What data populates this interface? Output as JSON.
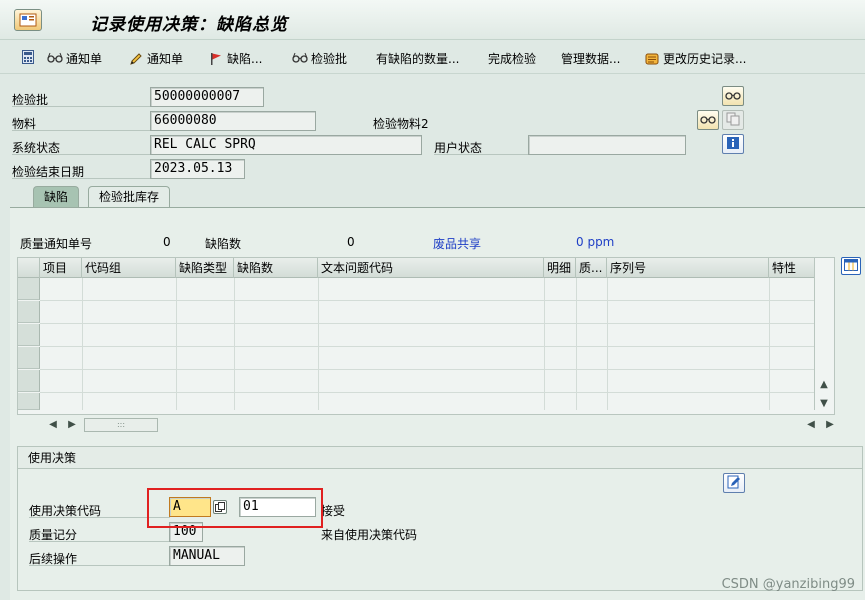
{
  "window": {
    "title": "记录使用决策：缺陷总览"
  },
  "toolbar": {
    "items": [
      {
        "label": "",
        "icon": "calculator-icon"
      },
      {
        "label": "通知单",
        "icon": "glasses-icon"
      },
      {
        "label": "通知单",
        "icon": "pencil-icon"
      },
      {
        "label": "缺陷...",
        "icon": "flag-icon"
      },
      {
        "label": "检验批",
        "icon": "glasses-icon"
      },
      {
        "label": "有缺陷的数量..."
      },
      {
        "label": "完成检验"
      },
      {
        "label": "管理数据..."
      },
      {
        "label": "更改历史记录...",
        "icon": "scroll-icon"
      }
    ]
  },
  "header": {
    "inspection_lot_label": "检验批",
    "inspection_lot_value": "50000000007",
    "material_label": "物料",
    "material_value": "66000080",
    "inspection_material_label": "检验物料2",
    "system_status_label": "系统状态",
    "system_status_value": "REL  CALC SPRQ",
    "user_status_label": "用户状态",
    "user_status_value": "",
    "end_date_label": "检验结束日期",
    "end_date_value": "2023.05.13"
  },
  "tabs": [
    {
      "label": "缺陷",
      "active": true
    },
    {
      "label": "检验批库存",
      "active": false
    }
  ],
  "defects": {
    "notification_count_label": "质量通知单号",
    "notification_count_value": "0",
    "defect_count_label": "缺陷数",
    "defect_count_value": "0",
    "scrap_share_label": "废品共享",
    "scrap_share_value": "0 ppm",
    "columns": [
      "项目",
      "代码组",
      "缺陷类型",
      "缺陷数",
      "文本问题代码",
      "明细",
      "质...",
      "序列号",
      "特性"
    ],
    "rows": []
  },
  "usage_decision": {
    "group_title": "使用决策",
    "code_label": "使用决策代码",
    "code_value": "A",
    "code_detail_value": "01",
    "code_text": "接受",
    "quality_score_label": "质量记分",
    "quality_score_value": "100",
    "quality_score_text": "来自使用决策代码",
    "followup_label": "后续操作",
    "followup_value": "MANUAL"
  },
  "watermark": "CSDN @yanzibing99",
  "colors": {
    "highlight_border": "#e02020",
    "input_active": "#ffe58a",
    "link_blue": "#1f3fc6"
  }
}
